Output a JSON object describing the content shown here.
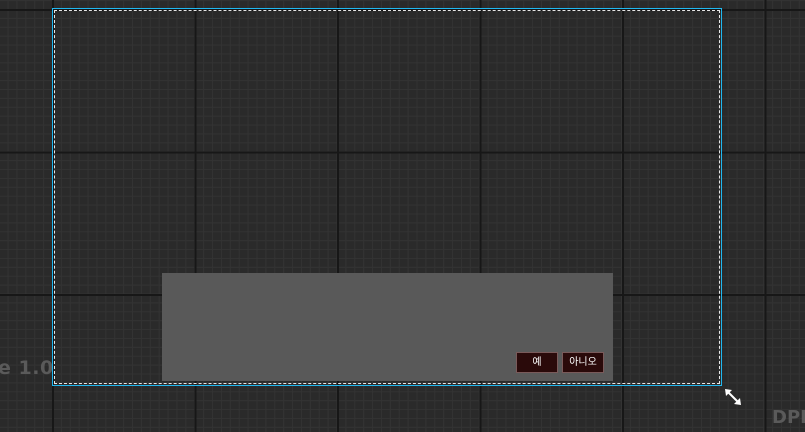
{
  "canvas": {
    "scale_label": "e 1.0",
    "dpi_label": "DPI"
  },
  "dialog": {
    "buttons": {
      "yes_label": "예",
      "no_label": "아니오"
    }
  },
  "colors": {
    "frame_border": "#20b8f0",
    "dialog_background": "#595959",
    "button_background": "#2a0a0a"
  },
  "icons": {
    "resize": "diagonal-resize-arrows-icon"
  }
}
